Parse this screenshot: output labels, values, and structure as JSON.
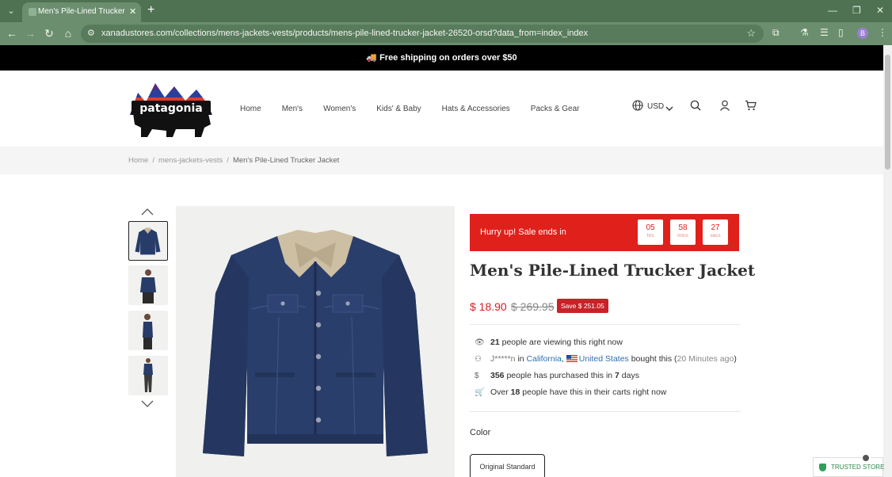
{
  "browser": {
    "tab_title": "Men's Pile-Lined Trucker Jacket",
    "url": "xanadustores.com/collections/mens-jackets-vests/products/mens-pile-lined-trucker-jacket-26520-orsd?data_from=index_index",
    "profile_initial": "B"
  },
  "announcement": "🚚 Free shipping on orders over $50",
  "logo_text": "patagonia",
  "nav": [
    "Home",
    "Men's",
    "Women's",
    "Kids' & Baby",
    "Hats & Accessories",
    "Packs & Gear"
  ],
  "currency": "USD",
  "breadcrumb": {
    "home": "Home",
    "collection": "mens-jackets-vests",
    "current": "Men's Pile-Lined Trucker Jacket"
  },
  "timer": {
    "label": "Hurry up!  Sale ends in",
    "hours": "05",
    "hours_unit": "hrs",
    "mins": "58",
    "mins_unit": "mins",
    "secs": "27",
    "secs_unit": "secs"
  },
  "product": {
    "title": "Men's Pile-Lined Trucker Jacket",
    "price": "$ 18.90",
    "compare_price": "$ 269.95",
    "save": "Save $ 251.05"
  },
  "social": {
    "viewing_count": "21",
    "viewing_text": " people are viewing this right now",
    "buyer_name": "J*****n",
    "buyer_in": " in ",
    "buyer_state": "California",
    "buyer_sep": ", ",
    "buyer_country": "United States",
    "buyer_text": " bought this (",
    "buyer_time": "20 Minutes ago",
    "buyer_close": ")",
    "purchased_count": "356",
    "purchased_text": " people has purchased this in ",
    "purchased_days": "7",
    "purchased_unit": " days",
    "carts_prefix": "Over ",
    "carts_count": "18",
    "carts_text": " people have this in their carts right now"
  },
  "color_label": "Color",
  "variant_selected": "Original Standard",
  "trusted_store": "TRUSTED STORE",
  "colors": {
    "accent_red": "#e0201b",
    "chrome_green": "#6b8f6e",
    "price_red": "#d51f23"
  }
}
